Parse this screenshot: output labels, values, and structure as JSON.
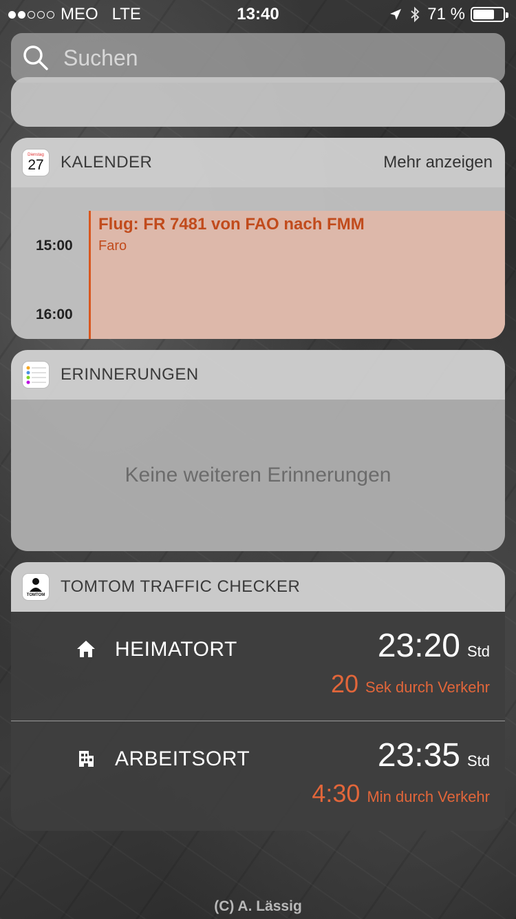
{
  "status_bar": {
    "carrier": "MEO",
    "network": "LTE",
    "time": "13:40",
    "battery_text": "71 %",
    "battery_level": 0.71,
    "signal_bars_filled": 2,
    "signal_bars_total": 5,
    "icons": [
      "location-arrow-icon",
      "bluetooth-icon",
      "battery-icon"
    ]
  },
  "search": {
    "placeholder": "Suchen"
  },
  "calendar": {
    "title": "KALENDER",
    "more_label": "Mehr anzeigen",
    "icon_day_name": "Dienstag",
    "icon_day_number": "27",
    "times": [
      "15:00",
      "16:00"
    ],
    "event": {
      "title": "Flug: FR 7481 von FAO nach FMM",
      "location": "Faro",
      "color": "#c14b1c"
    }
  },
  "reminders": {
    "title": "ERINNERUNGEN",
    "empty_text": "Keine weiteren Erinnerungen"
  },
  "tomtom": {
    "title": "TOMTOM TRAFFIC CHECKER",
    "icon_label": "TOMTOM",
    "routes": [
      {
        "icon": "home-icon",
        "name": "HEIMATORT",
        "time": "23:20",
        "time_unit": "Std",
        "delay_value": "20",
        "delay_text": "Sek durch Verkehr"
      },
      {
        "icon": "office-building-icon",
        "name": "ARBEITSORT",
        "time": "23:35",
        "time_unit": "Std",
        "delay_value": "4:30",
        "delay_text": "Min durch Verkehr"
      }
    ],
    "delay_color": "#e2663a"
  },
  "watermark": "(C) A. Lässig"
}
